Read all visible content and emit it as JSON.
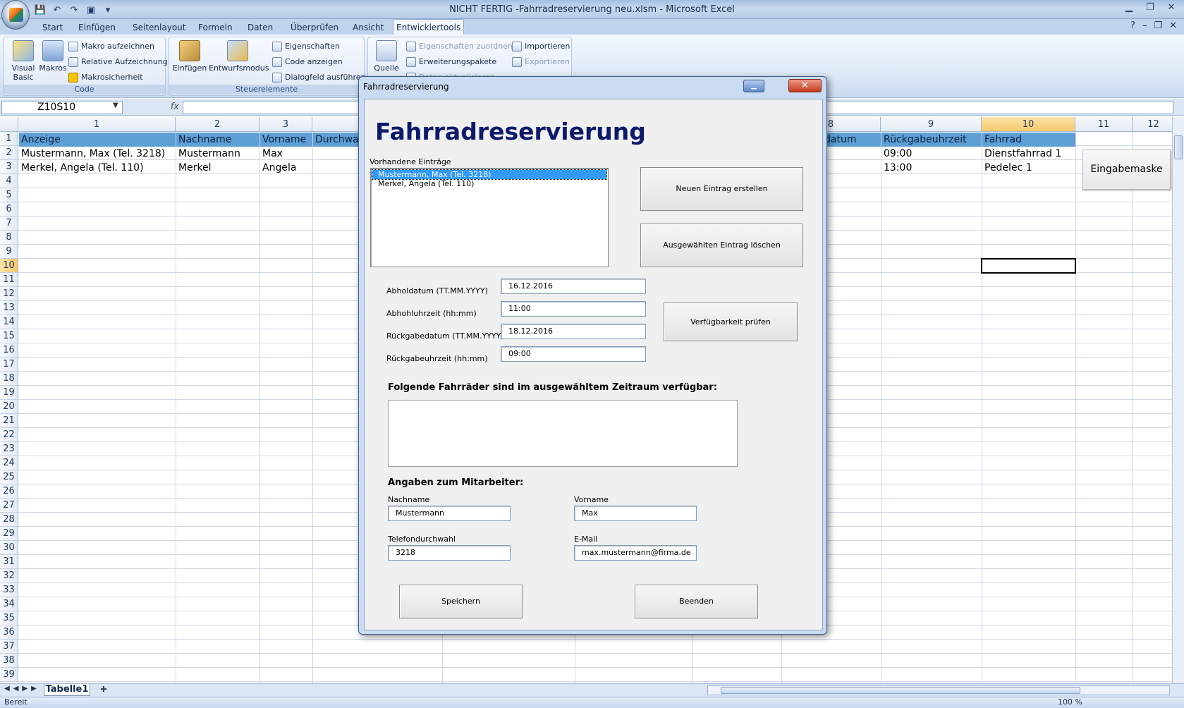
{
  "window": {
    "title": "NICHT FERTIG -Fahrradreservierung neu.xlsm - Microsoft Excel"
  },
  "ribbon": {
    "tabs": [
      "Start",
      "Einfügen",
      "Seitenlayout",
      "Formeln",
      "Daten",
      "Überprüfen",
      "Ansicht",
      "Entwicklertools"
    ],
    "active_tab": "Entwicklertools",
    "groups": {
      "code": {
        "label": "Code",
        "visual_basic": "Visual Basic",
        "makros": "Makros",
        "makro_aufzeichnen": "Makro aufzeichnen",
        "relative_aufzeichnung": "Relative Aufzeichnung",
        "makrosicherheit": "Makrosicherheit"
      },
      "steuerelemente": {
        "label": "Steuerelemente",
        "einfuegen": "Einfügen",
        "entwurfsmodus": "Entwurfsmodus",
        "eigenschaften": "Eigenschaften",
        "code_anzeigen": "Code anzeigen",
        "dialogfeld": "Dialogfeld ausführen"
      },
      "xml": {
        "quelle": "Quelle",
        "eigenschaften_zuordnen": "Eigenschaften zuordnen",
        "erweiterungspakete": "Erweiterungspakete",
        "daten_aktualisieren": "Daten aktualisieren",
        "importieren": "Importieren",
        "exportieren": "Exportieren"
      }
    }
  },
  "formula_bar": {
    "name_box": "Z10S10",
    "fx": "fx",
    "formula": ""
  },
  "sheet": {
    "columns": [
      "1",
      "2",
      "3",
      "8",
      "9",
      "10",
      "11",
      "12"
    ],
    "rows": [
      "1",
      "2",
      "3",
      "4",
      "5",
      "6",
      "7",
      "8",
      "9",
      "10",
      "11",
      "12",
      "13",
      "14",
      "15",
      "16",
      "17",
      "18",
      "19",
      "20",
      "21",
      "22",
      "23",
      "24",
      "25",
      "26",
      "27",
      "28",
      "29",
      "30",
      "31",
      "32",
      "33",
      "34",
      "35",
      "36",
      "37",
      "38",
      "39"
    ],
    "headers": {
      "c1": "Anzeige",
      "c2": "Nachname",
      "c3": "Vorname",
      "c4": "Durchwah",
      "c8": "datum",
      "c9": "Rückgabeuhrzeit",
      "c10": "Fahrrad"
    },
    "row2": {
      "c1": "Mustermann, Max (Tel. 3218)",
      "c2": "Mustermann",
      "c3": "Max",
      "c9": "09:00",
      "c10": "Dienstfahrrad 1"
    },
    "row3": {
      "c1": "Merkel, Angela (Tel. 110)",
      "c2": "Merkel",
      "c3": "Angela",
      "c9": "13:00",
      "c10": "Pedelec 1"
    },
    "button": "Eingabemaske",
    "sheet_tab": "Tabelle1",
    "status": "Bereit",
    "zoom": "100 %"
  },
  "dialog": {
    "title": "Fahrradreservierung",
    "heading": "Fahrradreservierung",
    "list_label": "Vorhandene Einträge",
    "entries": [
      "Mustermann, Max (Tel. 3218)",
      "Merkel, Angela (Tel. 110)"
    ],
    "btn_new": "Neuen Eintrag erstellen",
    "btn_delete": "Ausgewählten Eintrag löschen",
    "lbl_abholdatum": "Abholdatum (TT.MM.YYYY)",
    "lbl_abholuhrzeit": "Abhohluhrzeit (hh:mm)",
    "lbl_rueckgabedatum": "Rückgabedatum (TT.MM.YYYY)",
    "lbl_rueckgabeuhrzeit": "Rückgabeuhrzeit (hh:mm)",
    "abholdatum": "16.12.2016",
    "abholuhrzeit": "11:00",
    "rueckgabedatum": "18.12.2016",
    "rueckgabeuhrzeit": "09:00",
    "btn_check": "Verfügbarkeit prüfen",
    "available_heading": "Folgende Fahrräder sind im ausgewähltem Zeitraum verfügbar:",
    "employee_heading": "Angaben zum Mitarbeiter:",
    "lbl_nachname": "Nachname",
    "lbl_vorname": "Vorname",
    "lbl_telefon": "Telefondurchwahl",
    "lbl_email": "E-Mail",
    "nachname": "Mustermann",
    "vorname": "Max",
    "telefon": "3218",
    "email": "max.mustermann@firma.de",
    "btn_save": "Speichern",
    "btn_exit": "Beenden"
  }
}
